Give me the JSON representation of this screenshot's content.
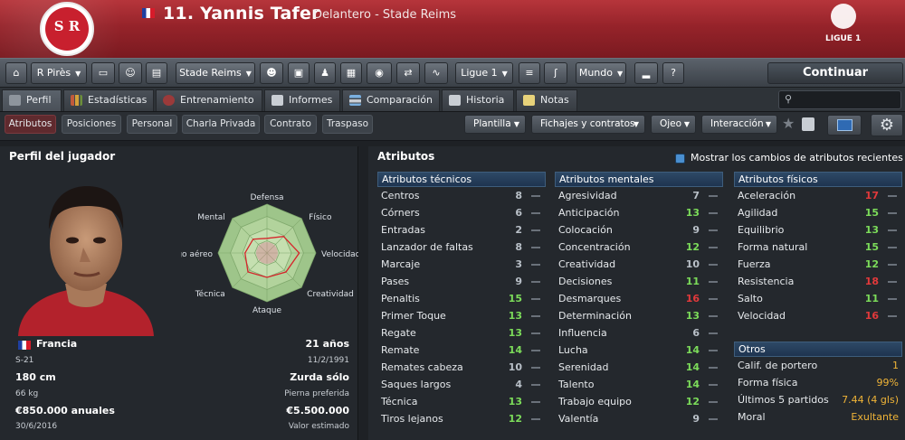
{
  "header": {
    "player_name": "11. Yannis Tafer",
    "subtitle": "Delantero - Stade Reims",
    "club_badge_text": "S R",
    "league_badge_text": "LIGUE 1"
  },
  "toolbar": {
    "manager_select": "R Pirès",
    "club_select": "Stade Reims",
    "league_select": "Ligue 1",
    "world_select": "Mundo",
    "continue_label": "Continuar"
  },
  "tabs": [
    {
      "label": "Perfil"
    },
    {
      "label": "Estadísticas"
    },
    {
      "label": "Entrenamiento"
    },
    {
      "label": "Informes"
    },
    {
      "label": "Comparación"
    },
    {
      "label": "Historia"
    },
    {
      "label": "Notas"
    }
  ],
  "subtabs": [
    {
      "label": "Atributos"
    },
    {
      "label": "Posiciones"
    },
    {
      "label": "Personal"
    },
    {
      "label": "Charla Privada"
    },
    {
      "label": "Contrato"
    },
    {
      "label": "Traspaso"
    }
  ],
  "dropdowns": {
    "squad": "Plantilla",
    "transfers": "Fichajes y contratos",
    "scout": "Ojeo",
    "interaction": "Interacción"
  },
  "profile": {
    "heading": "Perfil del jugador",
    "radar_labels": [
      "Defensa",
      "Físico",
      "Velocidad",
      "Creatividad",
      "Ataque",
      "Técnica",
      "go aéreo",
      "Mental"
    ],
    "radar_values": [
      0.3,
      0.48,
      0.66,
      0.55,
      0.5,
      0.55,
      0.45,
      0.4
    ],
    "nation": "Francia",
    "age": "21 años",
    "youth_level": "S-21",
    "dob": "11/2/1991",
    "height": "180 cm",
    "foot": "Zurda sólo",
    "weight": "66 kg",
    "foot_label": "Pierna preferida",
    "wage": "€850.000 anuales",
    "value": "€5.500.000",
    "contract_end": "30/6/2016",
    "value_label": "Valor estimado"
  },
  "attributes": {
    "heading": "Atributos",
    "show_changes_label": "Mostrar los cambios de atributos recientes",
    "show_changes_checked": true,
    "technical": {
      "title": "Atributos técnicos",
      "items": [
        {
          "name": "Centros",
          "value": "8"
        },
        {
          "name": "Córners",
          "value": "6"
        },
        {
          "name": "Entradas",
          "value": "2"
        },
        {
          "name": "Lanzador de faltas",
          "value": "8"
        },
        {
          "name": "Marcaje",
          "value": "3"
        },
        {
          "name": "Pases",
          "value": "9"
        },
        {
          "name": "Penaltis",
          "value": "15"
        },
        {
          "name": "Primer Toque",
          "value": "13"
        },
        {
          "name": "Regate",
          "value": "13"
        },
        {
          "name": "Remate",
          "value": "14"
        },
        {
          "name": "Remates cabeza",
          "value": "10"
        },
        {
          "name": "Saques largos",
          "value": "4"
        },
        {
          "name": "Técnica",
          "value": "13"
        },
        {
          "name": "Tiros lejanos",
          "value": "12"
        }
      ]
    },
    "mental": {
      "title": "Atributos mentales",
      "items": [
        {
          "name": "Agresividad",
          "value": "7"
        },
        {
          "name": "Anticipación",
          "value": "13"
        },
        {
          "name": "Colocación",
          "value": "9"
        },
        {
          "name": "Concentración",
          "value": "12"
        },
        {
          "name": "Creatividad",
          "value": "10"
        },
        {
          "name": "Decisiones",
          "value": "11"
        },
        {
          "name": "Desmarques",
          "value": "16"
        },
        {
          "name": "Determinación",
          "value": "13"
        },
        {
          "name": "Influencia",
          "value": "6"
        },
        {
          "name": "Lucha",
          "value": "14"
        },
        {
          "name": "Serenidad",
          "value": "14"
        },
        {
          "name": "Talento",
          "value": "14"
        },
        {
          "name": "Trabajo equipo",
          "value": "12"
        },
        {
          "name": "Valentía",
          "value": "9"
        }
      ]
    },
    "physical": {
      "title": "Atributos físicos",
      "items": [
        {
          "name": "Aceleración",
          "value": "17"
        },
        {
          "name": "Agilidad",
          "value": "15"
        },
        {
          "name": "Equilibrio",
          "value": "13"
        },
        {
          "name": "Forma natural",
          "value": "15"
        },
        {
          "name": "Fuerza",
          "value": "12"
        },
        {
          "name": "Resistencia",
          "value": "18"
        },
        {
          "name": "Salto",
          "value": "11"
        },
        {
          "name": "Velocidad",
          "value": "16"
        }
      ]
    },
    "other": {
      "title": "Otros",
      "items": [
        {
          "name": "Calif. de portero",
          "value": "1"
        },
        {
          "name": "Forma física",
          "value": "99%"
        },
        {
          "name": "Últimos 5 partidos",
          "value": "7.44 (4 gls)"
        },
        {
          "name": "Moral",
          "value": "Exultante"
        }
      ]
    }
  }
}
